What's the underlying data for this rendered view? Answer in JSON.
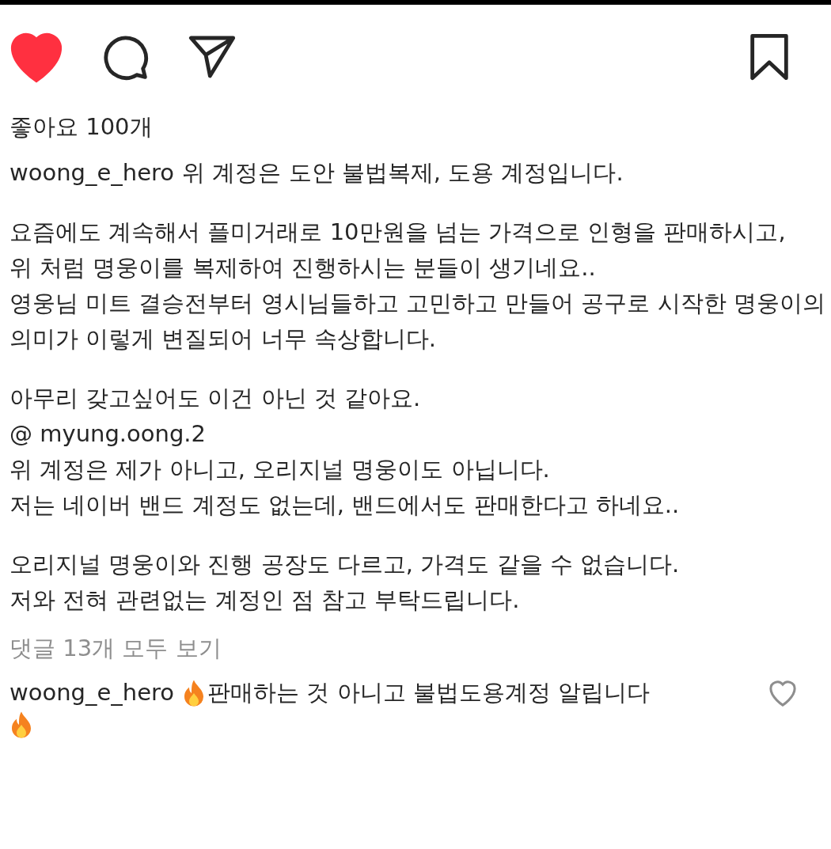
{
  "actions": {
    "liked": true,
    "saved": false
  },
  "likes": "좋아요 100개",
  "caption": {
    "username": "woong_e_hero",
    "paragraphs": [
      [
        "위 계정은 도안 불법복제, 도용 계정입니다."
      ],
      [
        "요즘에도 계속해서 플미거래로 10만원을 넘는 가격으로 인형을 판매하시고,",
        "위 처럼 명웅이를 복제하여 진행하시는 분들이 생기네요..",
        "영웅님 미트 결승전부터 영시님들하고 고민하고 만들어 공구로 시작한 명웅이의",
        "의미가 이렇게 변질되어 너무 속상합니다."
      ],
      [
        "아무리 갖고싶어도 이건 아닌 것 같아요.",
        "@ myung.oong.2",
        "위 계정은 제가 아니고, 오리지널 명웅이도 아닙니다.",
        "저는 네이버 밴드 계정도 없는데, 밴드에서도 판매한다고 하네요.."
      ],
      [
        "오리지널 명웅이와 진행 공장도 다르고, 가격도 같을 수 없습니다.",
        "저와 전혀 관련없는 계정인 점 참고 부탁드립니다."
      ]
    ]
  },
  "view_comments": "댓글 13개 모두 보기",
  "comment": {
    "username": "woong_e_hero",
    "text": "판매하는 것 아니고 불법도용계정 알립니다",
    "liked": false
  }
}
